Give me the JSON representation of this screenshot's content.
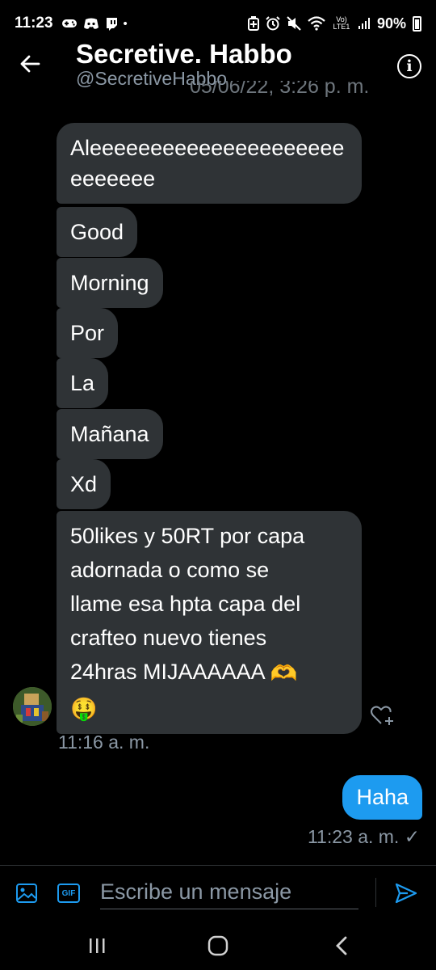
{
  "status_bar": {
    "time": "11:23",
    "battery": "90%",
    "network": "Vo) LTE1"
  },
  "header": {
    "title": "Secretive. Habbo",
    "handle": "@SecretiveHabbo",
    "ghost_timestamp": "05/06/22, 3:26 p. m."
  },
  "messages": {
    "received": [
      "Aleeeeeeeeeeeeeeeeeeeeeeeeeeee",
      "Good",
      "Morning",
      "Por",
      "La",
      "Mañana",
      "Xd"
    ],
    "long_message": {
      "line1": "50likes y 50RT por capa",
      "line2": "adornada o como se",
      "line3": "llame esa hpta capa del",
      "line4": "crafteo nuevo tienes",
      "line5": "24hras MIJAAAAAA",
      "emoji1": "🫶",
      "emoji2": "🤑"
    },
    "received_time": "11:16 a. m.",
    "sent": "Haha",
    "sent_time": "11:23 a. m.",
    "sent_check": "✓"
  },
  "composer": {
    "placeholder": "Escribe un mensaje",
    "gif_label": "GIF"
  },
  "colors": {
    "accent": "#1d9bf0",
    "bubble_received": "#2f3336",
    "background": "#000000",
    "secondary_text": "#8b98a5"
  }
}
